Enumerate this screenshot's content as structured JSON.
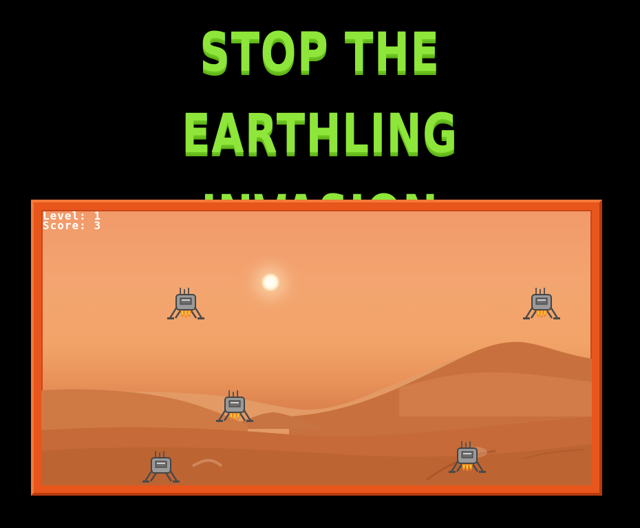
{
  "title": {
    "line1": "STOP THE",
    "line2": "EARTHLING INVASION"
  },
  "hud": {
    "level_label": "Level:",
    "level_value": "1",
    "score_label": "Score:",
    "score_value": "3"
  },
  "sprites": {
    "enemy": "lander-icon",
    "sun": "sun-icon"
  },
  "colors": {
    "title": "#8ee63a",
    "frame": "#e8561c",
    "background": "#000000",
    "hud_text": "#ffffff"
  }
}
